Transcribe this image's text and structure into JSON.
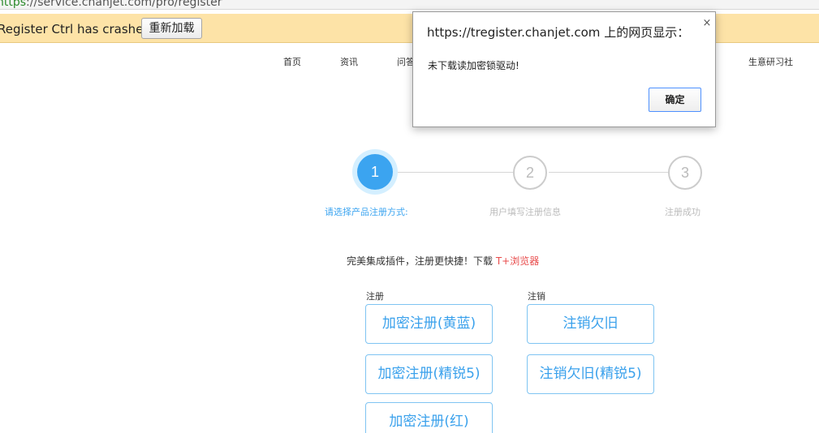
{
  "browser": {
    "url_scheme": "https",
    "url_rest": "://service.chanjet.com/pro/register"
  },
  "infobar": {
    "message": "Register Ctrl has crashed.",
    "reload_label": "重新加载"
  },
  "site_nav": {
    "items": [
      "首页",
      "资讯",
      "问答",
      "生意研习社"
    ]
  },
  "steps": [
    {
      "number": "1",
      "label": "请选择产品注册方式:",
      "active": true
    },
    {
      "number": "2",
      "label": "用户填写注册信息",
      "active": false
    },
    {
      "number": "3",
      "label": "注册成功",
      "active": false
    }
  ],
  "promo": {
    "text": "完美集成插件，注册更快捷！下载 ",
    "link": "T+浏览器"
  },
  "register_group": {
    "label": "注册",
    "buttons": [
      "加密注册(黄蓝)",
      "加密注册(精锐5)",
      "加密注册(红)"
    ]
  },
  "cancel_group": {
    "label": "注销",
    "buttons": [
      "注销欠旧",
      "注销欠旧(精锐5)"
    ]
  },
  "dialog": {
    "title": "https://tregister.chanjet.com 上的网页显示：",
    "message": "未下载读加密锁驱动!",
    "ok_label": "确定",
    "close_glyph": "×"
  },
  "colors": {
    "accent": "#3ba4f0",
    "infobar": "#fde3a7",
    "promo_link": "#e84b4b"
  }
}
